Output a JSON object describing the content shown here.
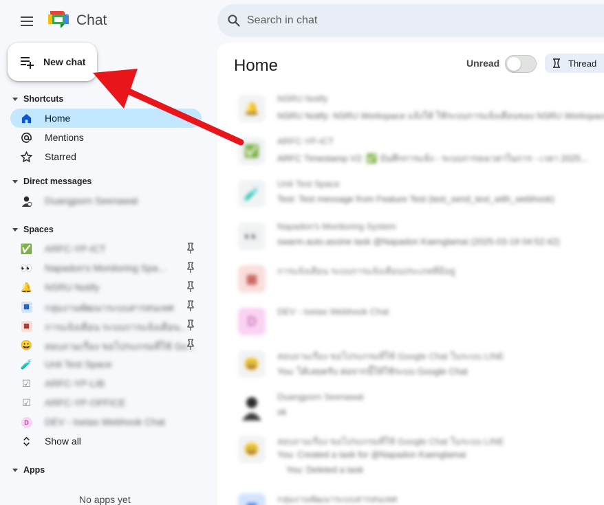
{
  "app": {
    "title": "Chat"
  },
  "search": {
    "placeholder": "Search in chat"
  },
  "new_chat": {
    "label": "New chat"
  },
  "shortcuts": {
    "heading": "Shortcuts",
    "items": [
      {
        "label": "Home",
        "icon": "home-icon",
        "active": true
      },
      {
        "label": "Mentions",
        "icon": "at-icon"
      },
      {
        "label": "Starred",
        "icon": "star-icon"
      }
    ]
  },
  "direct_messages": {
    "heading": "Direct messages",
    "items": [
      {
        "label": "Duangporn Seenawat"
      }
    ]
  },
  "spaces": {
    "heading": "Spaces",
    "items": [
      {
        "label": "ARFC-YP-ICT",
        "icon": "✅",
        "pinned": true
      },
      {
        "label": "Napadon's Monitoring Spa...",
        "icon": "👀",
        "pinned": true
      },
      {
        "label": "NSRU Notify",
        "icon": "🔔",
        "pinned": true
      },
      {
        "label": "กลุ่มงานพัฒนาระบบสารสนเทศ",
        "icon": "grid-blue",
        "pinned": true
      },
      {
        "label": "การแจ้งเตือน ระบบการแจ้งเตือน...",
        "icon": "grid-red",
        "pinned": true
      },
      {
        "label": "สอบถามเรื่อง ขอโปรแกรมที่ใช้ Go...",
        "icon": "😀",
        "pinned": true
      },
      {
        "label": "Unit Test Space",
        "icon": "🧪"
      },
      {
        "label": "ARFC-YP-LIB",
        "icon": "☑"
      },
      {
        "label": "ARFC-YP-OFFICE",
        "icon": "☑"
      },
      {
        "label": "DEV - Isetas Webhook Chat",
        "icon": "D"
      }
    ],
    "show_all": "Show all"
  },
  "apps": {
    "heading": "Apps",
    "empty": "No apps yet"
  },
  "main": {
    "title": "Home",
    "unread_label": "Unread",
    "thread_label": "Thread",
    "conversations": [
      {
        "name": "NSRU Notify",
        "message": "NSRU Notify: NSRU Workspace แจ้งให้ ใช้ระบบการแจ้งเตือนของ NSRU Workspace",
        "avatar": "🔔"
      },
      {
        "name": "ARFC-YP-ICT",
        "message": "ARFC Timestamp V2: ✅ บันทึกการแจ้ง - ระบบการลงเวลาในการ - เวลา 2025...",
        "avatar": "✅"
      },
      {
        "name": "Unit Test Space",
        "message": "Test: Test message from Feature Test (test_send_text_with_webhook)",
        "avatar": "🧪"
      },
      {
        "name": "Napadon's Monitoring System",
        "message": "swarm.auto.assine task @Napadon Kaenglamai (2025-03-19 04:52:42)",
        "avatar": "👀"
      },
      {
        "name": "การแจ้งเตือน ระบบการแจ้งเตือนประเภทที่มีอยู่",
        "message": "",
        "avatar": "grid-red"
      },
      {
        "name": "DEV - Isetas Webhook Chat",
        "message": "",
        "avatar": "D"
      },
      {
        "name": "สอบถามเรื่อง ขอโปรแกรมที่ใช้ Google Chat ในระบบ LINE",
        "message": "You: ได้เลยครับ ต่อจากนี้ให้ใช้ระบบ Google Chat",
        "avatar": "😀"
      },
      {
        "name": "Duangporn Seenawat",
        "message": "ok",
        "avatar": "person"
      },
      {
        "name": "สอบถามเรื่อง ขอโปรแกรมที่ใช้ Google Chat ในระบบ LINE",
        "message": "You: Created a task for @Napadon Kaenglamai",
        "extra": "You: Deleted a task",
        "avatar": "😀"
      },
      {
        "name": "กลุ่มงานพัฒนาระบบสารสนเทศ",
        "message": "",
        "avatar": "grid-blue"
      }
    ]
  },
  "colors": {
    "accent": "#c2e7ff",
    "arrow": "#e8161b",
    "background": "#f6f8fc"
  }
}
